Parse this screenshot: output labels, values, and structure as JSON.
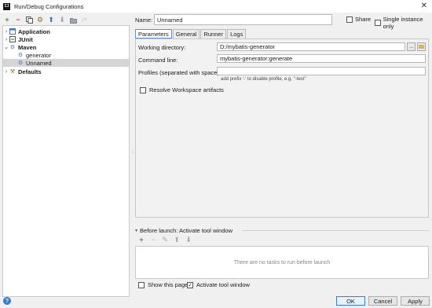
{
  "window": {
    "title": "Run/Debug Configurations",
    "app_logo": "IJ"
  },
  "left_toolbar": {
    "icons": [
      "add-icon",
      "remove-icon",
      "copy-icon",
      "settings-icon",
      "move-up-icon",
      "move-down-icon",
      "folder-icon",
      "sort-icon"
    ]
  },
  "tree": {
    "items": [
      {
        "label": "Application",
        "level": 0,
        "expanded": false,
        "bold": true,
        "icon": "application-icon"
      },
      {
        "label": "JUnit",
        "level": 0,
        "expanded": false,
        "bold": true,
        "icon": "junit-icon"
      },
      {
        "label": "Maven",
        "level": 0,
        "expanded": true,
        "bold": true,
        "icon": "maven-icon"
      },
      {
        "label": "generator",
        "level": 1,
        "bold": false,
        "icon": "gear-icon"
      },
      {
        "label": "Unnamed",
        "level": 1,
        "bold": false,
        "icon": "gear-icon",
        "selected": true
      },
      {
        "label": "Defaults",
        "level": 0,
        "expanded": false,
        "bold": true,
        "icon": "defaults-icon"
      }
    ]
  },
  "header": {
    "name_label": "Name:",
    "name_value": "Unnamed",
    "share_label": "Share",
    "share_checked": false,
    "single_instance_label": "Single instance only",
    "single_instance_checked": false
  },
  "tabs": [
    {
      "label": "Parameters",
      "active": true
    },
    {
      "label": "General",
      "active": false
    },
    {
      "label": "Runner",
      "active": false
    },
    {
      "label": "Logs",
      "active": false
    }
  ],
  "parameters": {
    "working_dir_label": "Working directory:",
    "working_dir_value": "D:/mybatis-generator",
    "browse_label": "...",
    "command_line_label": "Command line:",
    "command_line_value": "mybatis-generator:generate",
    "profiles_label": "Profiles (separated with space):",
    "profiles_value": "",
    "profiles_hint": "add prefix '-' to disable profile, e.g. \"-test\"",
    "resolve_label": "Resolve Workspace artifacts",
    "resolve_checked": false
  },
  "before_launch": {
    "title": "Before launch: Activate tool window",
    "empty_text": "There are no tasks to run before launch",
    "toolbar_icons": [
      "add-icon",
      "remove-icon",
      "edit-icon",
      "move-up-icon",
      "move-down-icon"
    ]
  },
  "footer": {
    "show_page_label": "Show this page",
    "show_page_checked": false,
    "activate_label": "Activate tool window",
    "activate_checked": true,
    "ok_label": "OK",
    "cancel_label": "Cancel",
    "apply_label": "Apply"
  },
  "colors": {
    "add_green": "#3a9a3a",
    "remove_red": "#c94040",
    "arrow_blue": "#3a77c4",
    "selection_gray": "#d5d5d5",
    "help_blue": "#2f7ed8"
  }
}
